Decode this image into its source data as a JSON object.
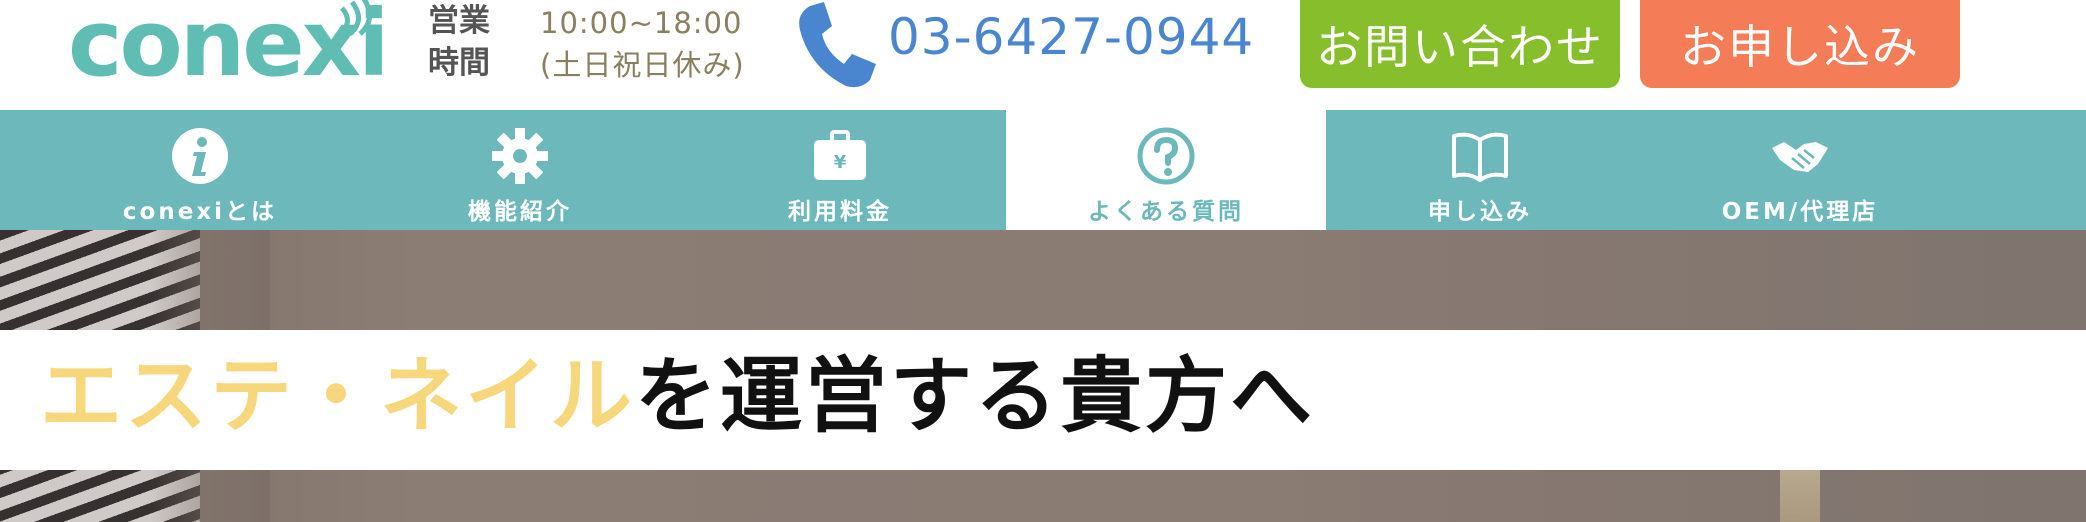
{
  "header": {
    "logo_text": "conexi",
    "business_hours_label": "営業時間",
    "business_hours_time": "10:00~18:00",
    "business_hours_note": "(土日祝日休み)",
    "phone_number": "03-6427-0944",
    "contact_button_label": "お問い合わせ",
    "apply_button_label": "お申し込み"
  },
  "nav": {
    "items": [
      {
        "label": "conexiとは",
        "icon": "info-icon"
      },
      {
        "label": "機能紹介",
        "icon": "gear-icon"
      },
      {
        "label": "利用料金",
        "icon": "yen-briefcase-icon"
      },
      {
        "label": "よくある質問",
        "icon": "question-icon",
        "active": true
      },
      {
        "label": "申し込み",
        "icon": "book-icon"
      },
      {
        "label": "OEM/代理店",
        "icon": "handshake-icon"
      }
    ]
  },
  "hero": {
    "title_highlight": "エステ・ネイル",
    "title_rest": "を運営する貴方へ"
  },
  "colors": {
    "brand_teal": "#5fbdb4",
    "nav_bg": "#6db8ba",
    "contact_green": "#86be2c",
    "apply_orange": "#f47d57",
    "phone_blue": "#4a86cf",
    "highlight_yellow": "#f7d77c"
  }
}
